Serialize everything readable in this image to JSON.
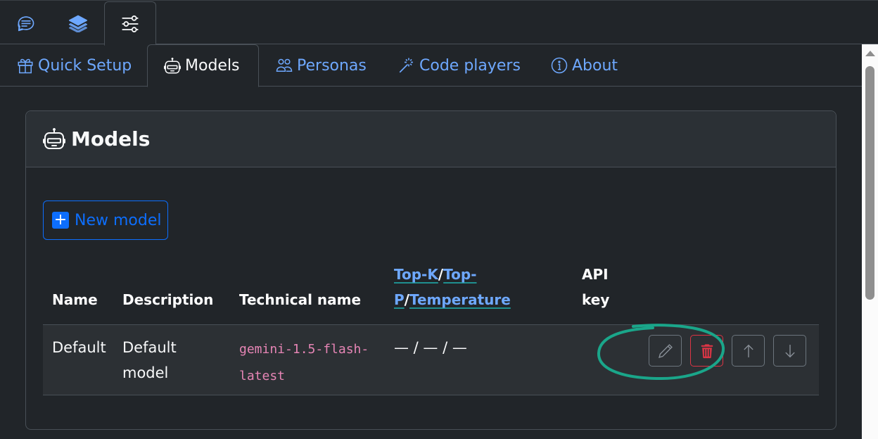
{
  "top_tabs": [
    {
      "icon": "chat-icon",
      "active": false
    },
    {
      "icon": "layers-icon",
      "active": false
    },
    {
      "icon": "sliders-icon",
      "active": true
    }
  ],
  "nav_tabs": [
    {
      "label": "Quick Setup",
      "icon": "gift-icon",
      "active": false
    },
    {
      "label": "Models",
      "icon": "robot-icon",
      "active": true
    },
    {
      "label": "Personas",
      "icon": "people-icon",
      "active": false
    },
    {
      "label": "Code players",
      "icon": "magic-wand-icon",
      "active": false
    },
    {
      "label": "About",
      "icon": "info-circle-icon",
      "active": false
    }
  ],
  "card": {
    "title": "Models",
    "title_icon": "robot-icon",
    "new_button_label": "New model"
  },
  "table": {
    "headers": {
      "name": "Name",
      "description": "Description",
      "technical_name": "Technical name",
      "params_topk": "Top-K",
      "params_slash1": "/",
      "params_topp_1": "Top-",
      "params_topp_2": "P",
      "params_slash2": "/",
      "params_temperature": "Temperature",
      "api_key_1": "API",
      "api_key_2": "key"
    },
    "rows": [
      {
        "name": "Default",
        "description_1": "Default",
        "description_2": "model",
        "technical_name_1": "gemini-1.5-flash-",
        "technical_name_2": "latest",
        "params": "— / — / —",
        "api_key": "",
        "actions": [
          "edit",
          "delete",
          "move-up",
          "move-down"
        ]
      }
    ]
  },
  "colors": {
    "background": "#212529",
    "link": "#6ea8fe",
    "primary": "#0d6efd",
    "danger": "#dc3545",
    "code": "#e685b5",
    "annotation": "#1aa68a"
  }
}
